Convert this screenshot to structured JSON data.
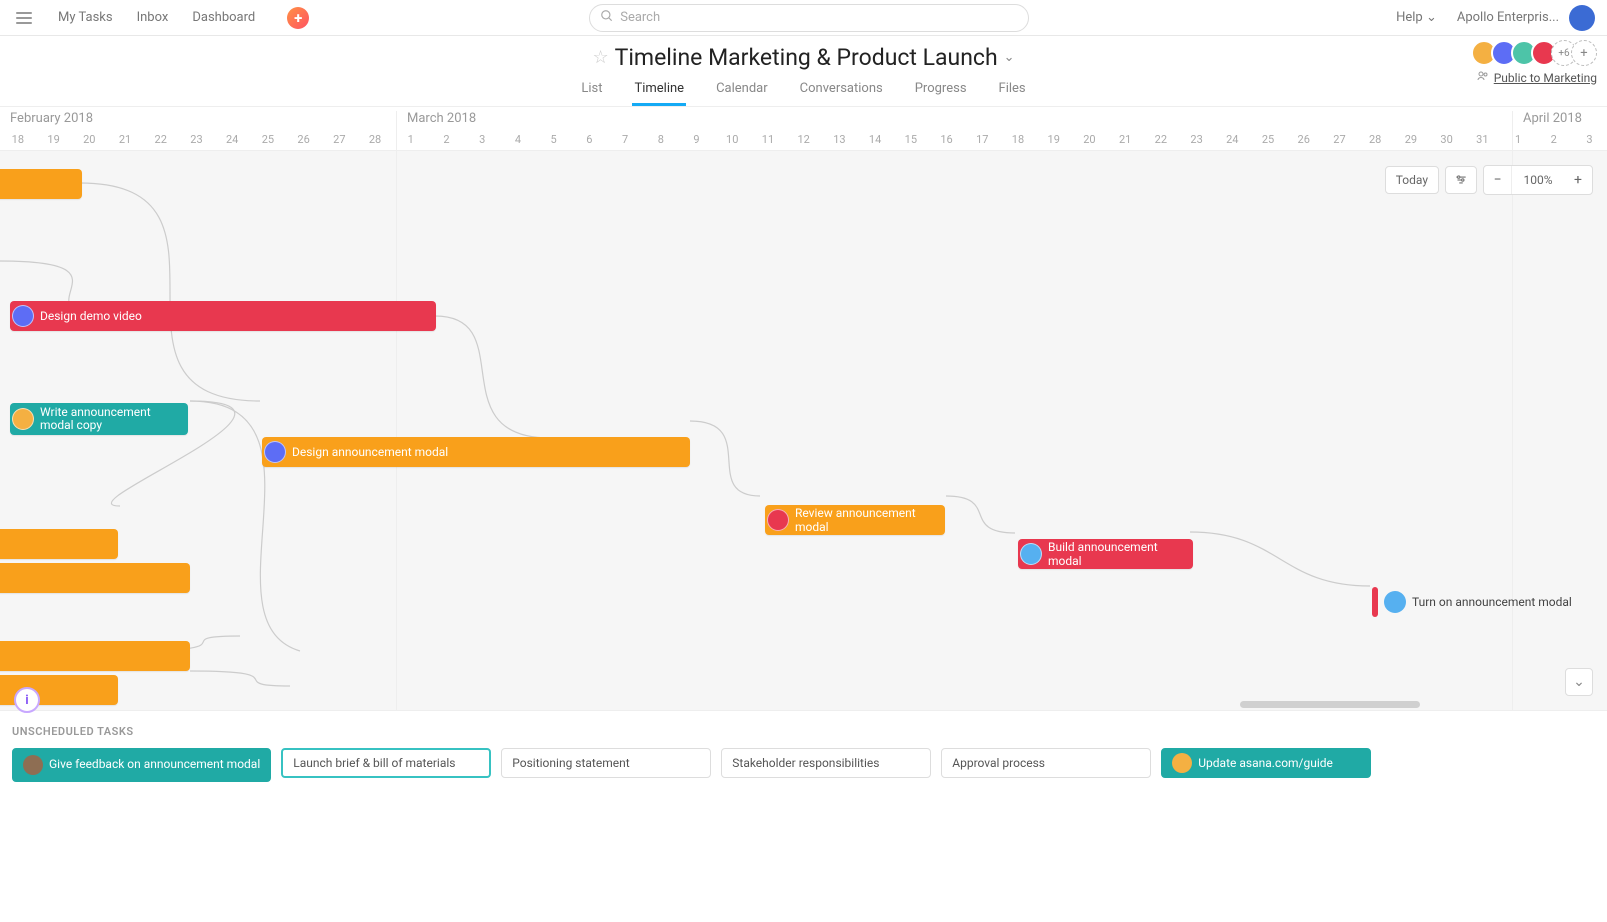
{
  "topnav": {
    "my_tasks": "My Tasks",
    "inbox": "Inbox",
    "dashboard": "Dashboard",
    "search_placeholder": "Search",
    "help": "Help",
    "workspace": "Apollo Enterpris..."
  },
  "project": {
    "title": "Timeline Marketing & Product Launch",
    "tabs": {
      "list": "List",
      "timeline": "Timeline",
      "calendar": "Calendar",
      "conversations": "Conversations",
      "progress": "Progress",
      "files": "Files"
    },
    "more_avatars": "+6",
    "visibility_label": "Public to Marketing"
  },
  "ruler": {
    "month1": "February 2018",
    "month2": "March 2018",
    "month3": "April 2018",
    "days": [
      "18",
      "19",
      "20",
      "21",
      "22",
      "23",
      "24",
      "25",
      "26",
      "27",
      "28",
      "1",
      "2",
      "3",
      "4",
      "5",
      "6",
      "7",
      "8",
      "9",
      "10",
      "11",
      "12",
      "13",
      "14",
      "15",
      "16",
      "17",
      "18",
      "19",
      "20",
      "21",
      "22",
      "23",
      "24",
      "25",
      "26",
      "27",
      "28",
      "29",
      "30",
      "31",
      "1",
      "2",
      "3"
    ]
  },
  "controls": {
    "today": "Today",
    "zoom": "100%"
  },
  "tasks": {
    "t1": "Design demo video",
    "t2": "Write announcement modal copy",
    "t3": "Design announcement modal",
    "t4": "Review announcement modal",
    "t5": "Build announcement modal",
    "t6": "Turn on announcement modal"
  },
  "unscheduled": {
    "title": "UNSCHEDULED TASKS",
    "cards": {
      "c1": "Give feedback on announcement modal",
      "c2": "Launch brief & bill of materials",
      "c3": "Positioning statement",
      "c4": "Stakeholder responsibilities",
      "c5": "Approval process",
      "c6": "Update asana.com/guide"
    }
  }
}
